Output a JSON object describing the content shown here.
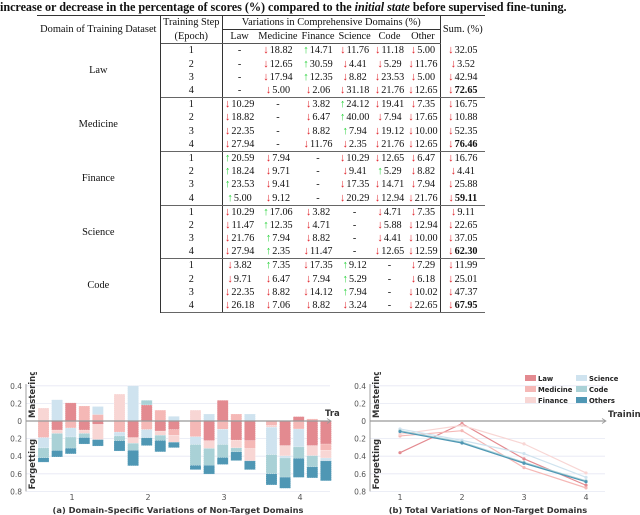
{
  "caption": {
    "part1": "increase or decrease in the percentage of scores (%) compared to the ",
    "italic": "initial state",
    "part2": " before supervised fine-tuning."
  },
  "table": {
    "headers": {
      "domain": "Domain of Training Dataset",
      "step_line1": "Training Step",
      "step_line2": "(Epoch)",
      "variations": "Variations in Comprehensive Domains (%)",
      "sum": "Sum. (%)",
      "columns": [
        "Law",
        "Medicine",
        "Finance",
        "Science",
        "Code",
        "Other"
      ]
    },
    "groups": [
      {
        "domain": "Law",
        "rows": [
          {
            "epoch": "1",
            "cells": [
              [
                "-",
                "-"
              ],
              [
                "d",
                "18.82"
              ],
              [
                "u",
                "14.71"
              ],
              [
                "d",
                "11.76"
              ],
              [
                "d",
                "11.18"
              ],
              [
                "d",
                "5.00"
              ]
            ],
            "sum": [
              "d",
              "32.05"
            ]
          },
          {
            "epoch": "2",
            "cells": [
              [
                "-",
                "-"
              ],
              [
                "d",
                "12.65"
              ],
              [
                "u",
                "30.59"
              ],
              [
                "d",
                "4.41"
              ],
              [
                "d",
                "5.29"
              ],
              [
                "d",
                "11.76"
              ]
            ],
            "sum": [
              "d",
              "3.52"
            ]
          },
          {
            "epoch": "3",
            "cells": [
              [
                "-",
                "-"
              ],
              [
                "d",
                "17.94"
              ],
              [
                "u",
                "12.35"
              ],
              [
                "d",
                "8.82"
              ],
              [
                "d",
                "23.53"
              ],
              [
                "d",
                "5.00"
              ]
            ],
            "sum": [
              "d",
              "42.94"
            ]
          },
          {
            "epoch": "4",
            "cells": [
              [
                "-",
                "-"
              ],
              [
                "d",
                "5.00"
              ],
              [
                "d",
                "2.06"
              ],
              [
                "d",
                "31.18"
              ],
              [
                "d",
                "21.76"
              ],
              [
                "d",
                "12.65"
              ]
            ],
            "sum": [
              "d",
              "72.65"
            ]
          }
        ]
      },
      {
        "domain": "Medicine",
        "rows": [
          {
            "epoch": "1",
            "cells": [
              [
                "d",
                "10.29"
              ],
              [
                "-",
                "-"
              ],
              [
                "d",
                "3.82"
              ],
              [
                "u",
                "24.12"
              ],
              [
                "d",
                "19.41"
              ],
              [
                "d",
                "7.35"
              ]
            ],
            "sum": [
              "d",
              "16.75"
            ]
          },
          {
            "epoch": "2",
            "cells": [
              [
                "d",
                "18.82"
              ],
              [
                "-",
                "-"
              ],
              [
                "d",
                "6.47"
              ],
              [
                "u",
                "40.00"
              ],
              [
                "d",
                "7.94"
              ],
              [
                "d",
                "17.65"
              ]
            ],
            "sum": [
              "d",
              "10.88"
            ]
          },
          {
            "epoch": "3",
            "cells": [
              [
                "d",
                "22.35"
              ],
              [
                "-",
                "-"
              ],
              [
                "d",
                "8.82"
              ],
              [
                "u",
                "7.94"
              ],
              [
                "d",
                "19.12"
              ],
              [
                "d",
                "10.00"
              ]
            ],
            "sum": [
              "d",
              "52.35"
            ]
          },
          {
            "epoch": "4",
            "cells": [
              [
                "d",
                "27.94"
              ],
              [
                "-",
                "-"
              ],
              [
                "d",
                "11.76"
              ],
              [
                "d",
                "2.35"
              ],
              [
                "d",
                "21.76"
              ],
              [
                "d",
                "12.65"
              ]
            ],
            "sum": [
              "d",
              "76.46"
            ]
          }
        ]
      },
      {
        "domain": "Finance",
        "rows": [
          {
            "epoch": "1",
            "cells": [
              [
                "u",
                "20.59"
              ],
              [
                "d",
                "7.94"
              ],
              [
                "-",
                "-"
              ],
              [
                "d",
                "10.29"
              ],
              [
                "d",
                "12.65"
              ],
              [
                "d",
                "6.47"
              ]
            ],
            "sum": [
              "d",
              "16.76"
            ]
          },
          {
            "epoch": "2",
            "cells": [
              [
                "u",
                "18.24"
              ],
              [
                "d",
                "9.71"
              ],
              [
                "-",
                "-"
              ],
              [
                "d",
                "9.41"
              ],
              [
                "u",
                "5.29"
              ],
              [
                "d",
                "8.82"
              ]
            ],
            "sum": [
              "d",
              "4.41"
            ]
          },
          {
            "epoch": "3",
            "cells": [
              [
                "u",
                "23.53"
              ],
              [
                "d",
                "9.41"
              ],
              [
                "-",
                "-"
              ],
              [
                "d",
                "17.35"
              ],
              [
                "d",
                "14.71"
              ],
              [
                "d",
                "7.94"
              ]
            ],
            "sum": [
              "d",
              "25.88"
            ]
          },
          {
            "epoch": "4",
            "cells": [
              [
                "u",
                "5.00"
              ],
              [
                "d",
                "9.12"
              ],
              [
                "-",
                "-"
              ],
              [
                "d",
                "20.29"
              ],
              [
                "d",
                "12.94"
              ],
              [
                "d",
                "21.76"
              ]
            ],
            "sum": [
              "d",
              "59.11"
            ]
          }
        ]
      },
      {
        "domain": "Science",
        "rows": [
          {
            "epoch": "1",
            "cells": [
              [
                "d",
                "10.29"
              ],
              [
                "u",
                "17.06"
              ],
              [
                "d",
                "3.82"
              ],
              [
                "-",
                "-"
              ],
              [
                "d",
                "4.71"
              ],
              [
                "d",
                "7.35"
              ]
            ],
            "sum": [
              "d",
              "9.11"
            ]
          },
          {
            "epoch": "2",
            "cells": [
              [
                "d",
                "11.47"
              ],
              [
                "u",
                "12.35"
              ],
              [
                "d",
                "4.71"
              ],
              [
                "-",
                "-"
              ],
              [
                "d",
                "5.88"
              ],
              [
                "d",
                "12.94"
              ]
            ],
            "sum": [
              "d",
              "22.65"
            ]
          },
          {
            "epoch": "3",
            "cells": [
              [
                "d",
                "21.76"
              ],
              [
                "u",
                "7.94"
              ],
              [
                "d",
                "8.82"
              ],
              [
                "-",
                "-"
              ],
              [
                "d",
                "4.41"
              ],
              [
                "d",
                "10.00"
              ]
            ],
            "sum": [
              "d",
              "37.05"
            ]
          },
          {
            "epoch": "4",
            "cells": [
              [
                "d",
                "27.94"
              ],
              [
                "u",
                "2.35"
              ],
              [
                "d",
                "11.47"
              ],
              [
                "-",
                "-"
              ],
              [
                "d",
                "12.65"
              ],
              [
                "d",
                "12.59"
              ]
            ],
            "sum": [
              "d",
              "62.30"
            ]
          }
        ]
      },
      {
        "domain": "Code",
        "rows": [
          {
            "epoch": "1",
            "cells": [
              [
                "d",
                "3.82"
              ],
              [
                "u",
                "7.35"
              ],
              [
                "d",
                "17.35"
              ],
              [
                "u",
                "9.12"
              ],
              [
                "-",
                "-"
              ],
              [
                "d",
                "7.29"
              ]
            ],
            "sum": [
              "d",
              "11.99"
            ]
          },
          {
            "epoch": "2",
            "cells": [
              [
                "d",
                "9.71"
              ],
              [
                "d",
                "6.47"
              ],
              [
                "d",
                "7.94"
              ],
              [
                "u",
                "5.29"
              ],
              [
                "-",
                "-"
              ],
              [
                "d",
                "6.18"
              ]
            ],
            "sum": [
              "d",
              "25.01"
            ]
          },
          {
            "epoch": "3",
            "cells": [
              [
                "d",
                "22.35"
              ],
              [
                "d",
                "8.82"
              ],
              [
                "d",
                "14.12"
              ],
              [
                "u",
                "7.94"
              ],
              [
                "-",
                "-"
              ],
              [
                "d",
                "10.02"
              ]
            ],
            "sum": [
              "d",
              "47.37"
            ]
          },
          {
            "epoch": "4",
            "cells": [
              [
                "d",
                "26.18"
              ],
              [
                "d",
                "7.06"
              ],
              [
                "d",
                "8.82"
              ],
              [
                "d",
                "3.24"
              ],
              [
                "-",
                "-"
              ],
              [
                "d",
                "22.65"
              ]
            ],
            "sum": [
              "d",
              "67.95"
            ]
          }
        ]
      }
    ]
  },
  "colors": {
    "down_arrow": "#e0232b",
    "up_arrow": "#28d23a",
    "Law": "#e38a90",
    "Medicine": "#f5b8b6",
    "Finance": "#f8d6d4",
    "Science": "#cfe3ef",
    "Code": "#a9d1d6",
    "Others": "#4f97b4"
  },
  "chart_data": [
    {
      "type": "bar",
      "stacked": "diverging",
      "title": "(a) Domain-Specific Variations of Non-Target Domains",
      "xlabel": "Training Epoch",
      "ylabel_top": "Mastering",
      "ylabel_bottom": "Forgetting",
      "categories": [
        "1",
        "2",
        "3",
        "4"
      ],
      "bars_per_category": [
        "Law",
        "Medicine",
        "Finance",
        "Science",
        "Code"
      ],
      "yticks": [
        "0.4",
        "0.2",
        "0",
        "0.2",
        "0.4",
        "0.6",
        "0.8"
      ],
      "ylim": [
        -0.8,
        0.4
      ],
      "segment_order": [
        "Law",
        "Medicine",
        "Finance",
        "Science",
        "Code",
        "Others"
      ],
      "note": "values are table variations / 100; positive = mastering (up), negative = forgetting (down)",
      "grid": true
    },
    {
      "type": "line",
      "title": "(b) Total Variations of Non-Target Domains",
      "xlabel": "Training Epoch",
      "ylabel_top": "Mastering",
      "ylabel_bottom": "Forgetting",
      "x": [
        "1",
        "2",
        "3",
        "4"
      ],
      "yticks": [
        "0.4",
        "0.2",
        "0",
        "0.2",
        "0.4",
        "0.6",
        "0.8"
      ],
      "ylim": [
        -0.8,
        0.4
      ],
      "legend": [
        "Law",
        "Medicine",
        "Finance",
        "Science",
        "Code",
        "Others"
      ],
      "legend_position": "top-right",
      "series": [
        {
          "name": "Law",
          "values": [
            -0.36,
            -0.03,
            -0.43,
            -0.73
          ]
        },
        {
          "name": "Medicine",
          "values": [
            -0.17,
            -0.11,
            -0.53,
            -0.76
          ]
        },
        {
          "name": "Finance",
          "values": [
            -0.15,
            -0.05,
            -0.26,
            -0.59
          ]
        },
        {
          "name": "Science",
          "values": [
            -0.09,
            -0.22,
            -0.37,
            -0.64
          ]
        },
        {
          "name": "Code",
          "values": [
            -0.11,
            -0.24,
            -0.47,
            -0.68
          ]
        },
        {
          "name": "Others",
          "values": [
            -0.12,
            -0.25,
            -0.48,
            -0.69
          ]
        }
      ],
      "grid": true
    }
  ]
}
